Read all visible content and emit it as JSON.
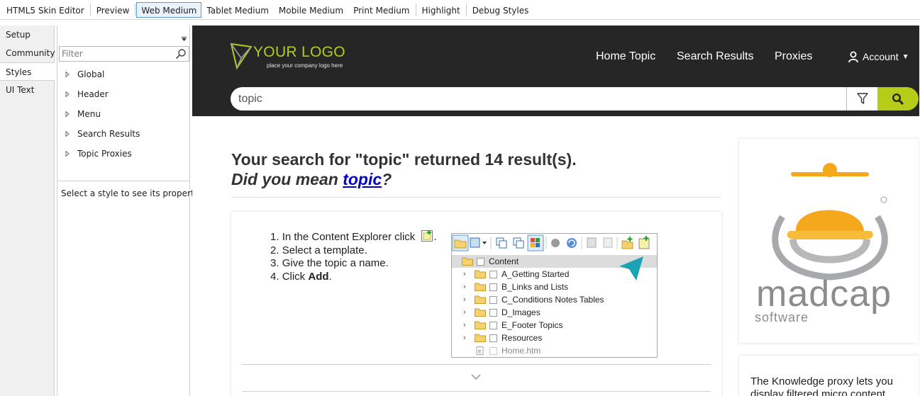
{
  "toolbar": {
    "items": [
      "HTML5 Skin Editor",
      "Preview",
      "Web Medium",
      "Tablet Medium",
      "Mobile Medium",
      "Print Medium",
      "Highlight",
      "Debug Styles"
    ],
    "active": "Web Medium"
  },
  "left_tabs": [
    "Setup",
    "Community",
    "Styles",
    "UI Text"
  ],
  "left_tabs_active": "Styles",
  "style_panel": {
    "filter_placeholder": "Filter",
    "tree": [
      "Global",
      "Header",
      "Menu",
      "Search Results",
      "Topic Proxies"
    ],
    "properties_hint": "Select a style to see its properties"
  },
  "preview": {
    "logo_text": "YOUR LOGO",
    "logo_tagline": "place your company logo here",
    "nav": [
      "Home Topic",
      "Search Results",
      "Proxies"
    ],
    "account_label": "Account",
    "search_value": "topic",
    "results_heading": "Your search for \"topic\" returned 14 result(s).",
    "did_you_mean_prefix": "Did you mean ",
    "did_you_mean_link": "topic",
    "did_you_mean_suffix": "?",
    "steps": [
      {
        "num": "1.",
        "text": "In the Content Explorer click "
      },
      {
        "num": "2.",
        "text": "Select a template."
      },
      {
        "num": "3.",
        "text": "Give the topic a name."
      },
      {
        "num": "4.",
        "pre": "Click ",
        "bold": "Add",
        "post": "."
      }
    ],
    "explorer": {
      "root": "Content",
      "items": [
        "A_Getting Started",
        "B_Links and Lists",
        "C_Conditions Notes Tables",
        "D_Images",
        "E_Footer Topics",
        "Resources",
        "Home.htm"
      ]
    },
    "side_text": "The Knowledge proxy lets you display filtered micro content",
    "colors": {
      "header_bg": "#262626",
      "accent_green": "#b5cc18",
      "link_blue": "#0000cc",
      "madcap_orange": "#f5a81c"
    }
  }
}
